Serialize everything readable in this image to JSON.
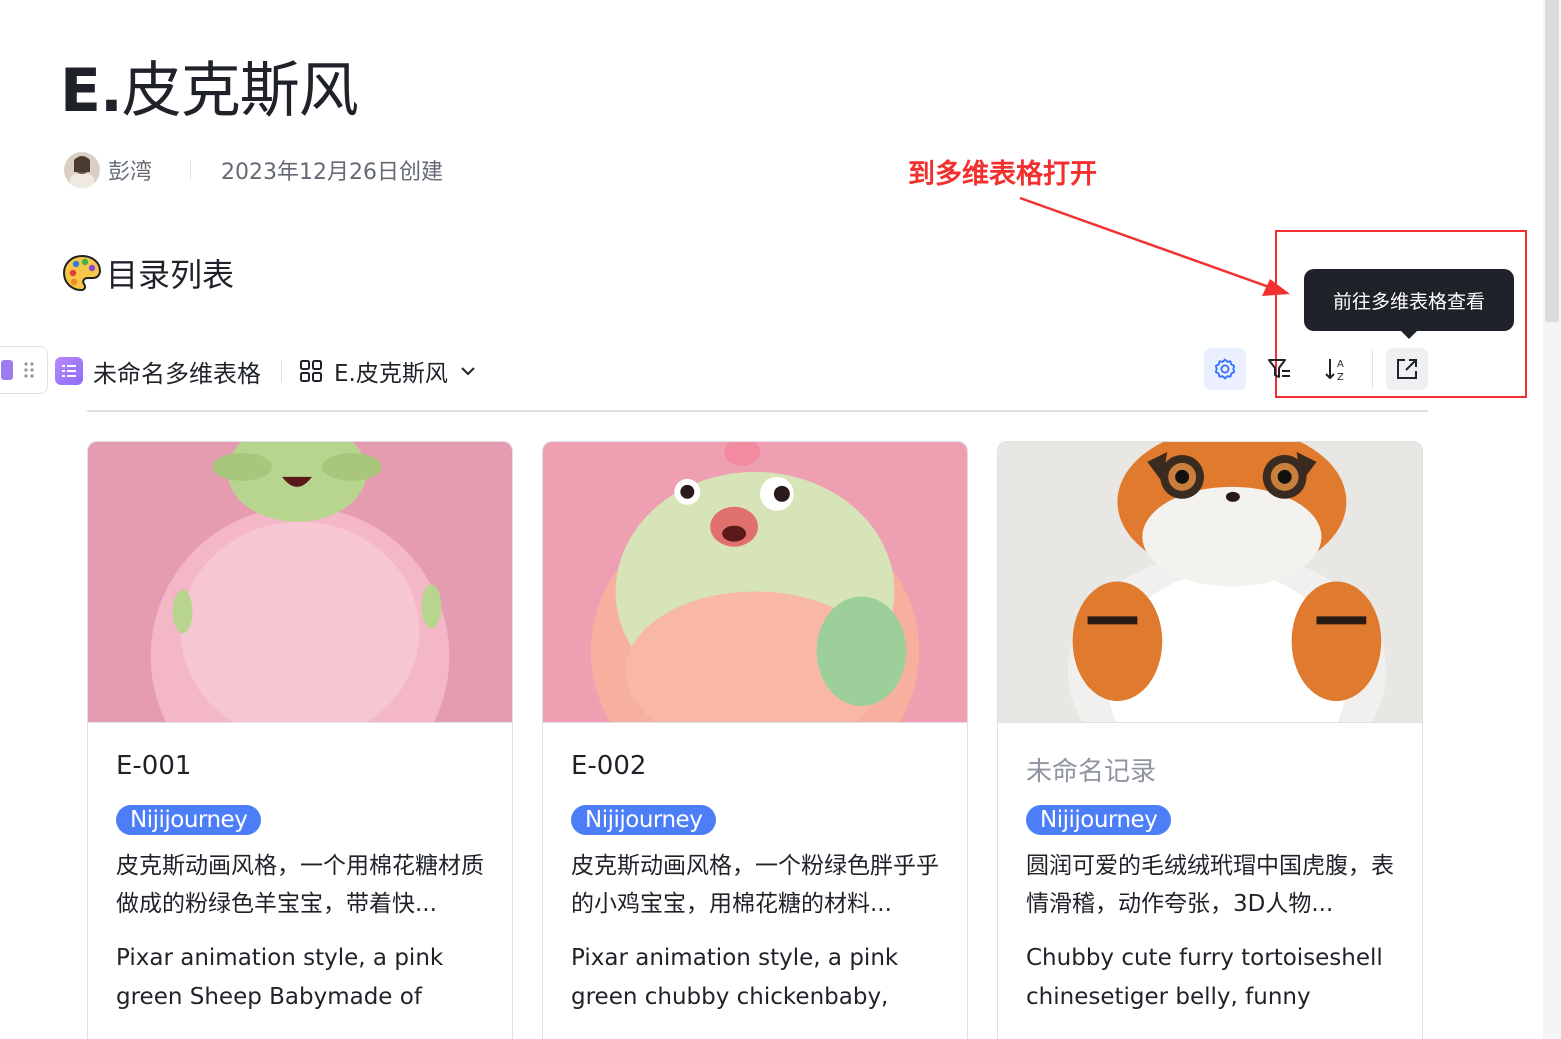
{
  "doc": {
    "title_prefix": "E.",
    "title_rest": "皮克斯风",
    "author": "彭湾",
    "created": "2023年12月26日创建"
  },
  "annotation": {
    "text": "到多维表格打开",
    "color": "#f23030"
  },
  "section": {
    "heading": "目录列表"
  },
  "bitable": {
    "name": "未命名多维表格",
    "view_name": "E.皮克斯风",
    "tooltip": "前往多维表格查看",
    "accent": "#4c7ef7"
  },
  "cards": [
    {
      "title": "E-001",
      "tag": "Nijijourney",
      "desc": "皮克斯动画风格，一个用棉花糖材质做成的粉绿色羊宝宝，带着快...",
      "en": "Pixar animation style, a pink green Sheep Babymade of cott..."
    },
    {
      "title": "E-002",
      "tag": "Nijijourney",
      "desc": "皮克斯动画风格，一个粉绿色胖乎乎的小鸡宝宝，用棉花糖的材料...",
      "en": "Pixar animation style, a pink green chubby chickenbaby, ma..."
    },
    {
      "title": "未命名记录",
      "tag": "Nijijourney",
      "desc": "圆润可爱的毛绒绒玳瑁中国虎腹，表情滑稽，动作夸张，3D人物...",
      "en": "Chubby cute furry tortoiseshell chinesetiger belly, funny facial..."
    }
  ]
}
